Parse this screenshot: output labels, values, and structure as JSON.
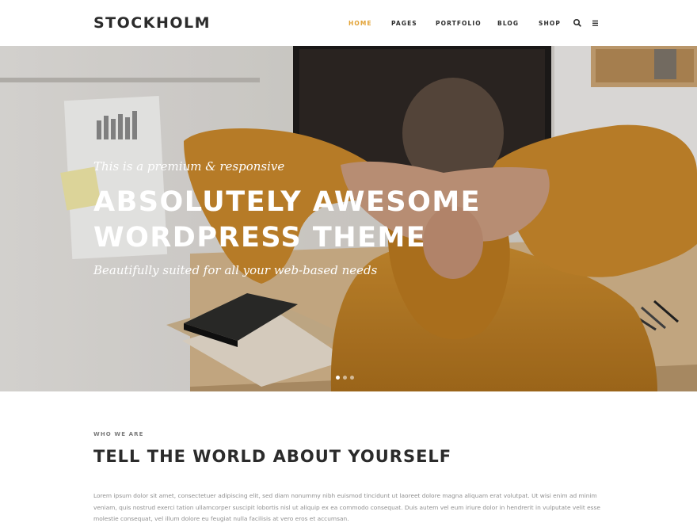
{
  "header": {
    "logo": "STOCKHOLM",
    "nav": [
      {
        "label": "HOME",
        "active": true
      },
      {
        "label": "PAGES",
        "active": false
      },
      {
        "label": "PORTFOLIO",
        "active": false
      },
      {
        "label": "BLOG",
        "active": false
      },
      {
        "label": "SHOP",
        "active": false
      }
    ],
    "icons": [
      "search-icon",
      "menu-icon"
    ],
    "accent_color": "#e2a235"
  },
  "hero": {
    "subtitle": "This is a premium & responsive",
    "title_line1": "ABSOLUTELY AWESOME",
    "title_line2": "WORDPRESS THEME",
    "tagline": "Beautifully suited for all your web-based needs",
    "slides": 3,
    "active_slide": 1
  },
  "about": {
    "kicker": "WHO WE ARE",
    "title": "TELL THE WORLD ABOUT YOURSELF",
    "paragraph": "Lorem ipsum dolor sit amet, consectetuer adipiscing elit, sed diam nonummy nibh euismod tincidunt ut laoreet dolore magna aliquam erat volutpat. Ut wisi enim ad minim veniam, quis nostrud exerci tation ullamcorper suscipit lobortis nisl ut aliquip ex ea commodo consequat. Duis autem vel eum iriure dolor in hendrerit in vulputate velit esse molestie consequat, vel illum dolore eu feugiat nulla facilisis at vero eros et accumsan."
  }
}
